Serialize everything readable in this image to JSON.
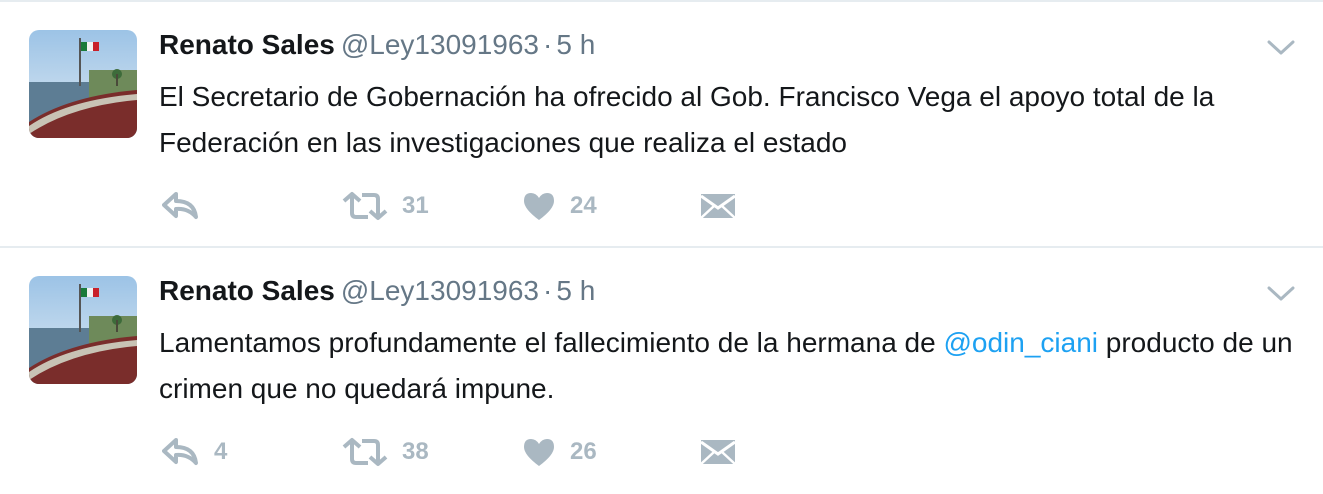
{
  "tweets": [
    {
      "fullname": "Renato Sales",
      "username": "@Ley13091963",
      "separator": "·",
      "time": "5 h",
      "text_before": "El Secretario de Gobernación ha ofrecido al Gob. Francisco Vega el apoyo total de la Federación en las investigaciones que realiza el estado",
      "mention": "",
      "text_after": "",
      "replies": "",
      "retweets": "31",
      "likes": "24"
    },
    {
      "fullname": "Renato Sales",
      "username": "@Ley13091963",
      "separator": "·",
      "time": "5 h",
      "text_before": "Lamentamos profundamente el fallecimiento de la hermana de ",
      "mention": "@odin_ciani",
      "text_after": " producto de un crimen que no quedará impune.",
      "replies": "4",
      "retweets": "38",
      "likes": "26"
    }
  ],
  "icons": {
    "reply": "reply-icon",
    "retweet": "retweet-icon",
    "like": "heart-icon",
    "dm": "envelope-icon",
    "menu": "chevron-down-icon"
  },
  "colors": {
    "text": "#14171a",
    "secondary": "#657786",
    "action": "#aab8c2",
    "mention": "#1da1f2",
    "border": "#e6ecf0"
  }
}
